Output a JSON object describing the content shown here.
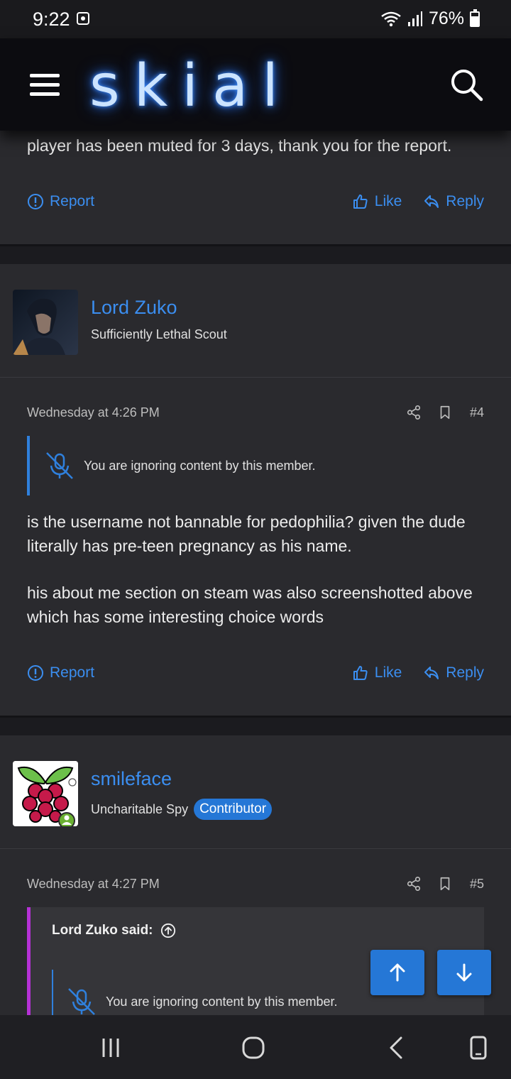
{
  "status_bar": {
    "time": "9:22",
    "battery": "76%"
  },
  "header": {
    "logo": "skial",
    "menu_icon": "hamburger-menu-icon",
    "search_icon": "search-icon"
  },
  "posts": [
    {
      "text_fragment": "player has been muted for 3 days, thank you for the report.",
      "actions": {
        "report": "Report",
        "like": "Like",
        "reply": "Reply"
      }
    },
    {
      "username": "Lord Zuko",
      "user_title": "Sufficiently Lethal Scout",
      "date": "Wednesday at 4:26 PM",
      "post_number": "#4",
      "ignored_notice": "You are ignoring content by this member.",
      "paragraphs": [
        "is the username not bannable for pedophilia? given the dude literally has pre-teen pregnancy as his name.",
        "his about me section on steam was also screenshotted above which has some interesting choice words"
      ],
      "actions": {
        "report": "Report",
        "like": "Like",
        "reply": "Reply"
      }
    },
    {
      "username": "smileface",
      "user_title": "Uncharitable Spy",
      "badge": "Contributor",
      "date": "Wednesday at 4:27 PM",
      "post_number": "#5",
      "quote_author": "Lord Zuko said:",
      "ignored_notice": "You are ignoring content by this member."
    }
  ],
  "colors": {
    "accent": "#3b8ef0",
    "badge": "#2577d6",
    "quote_border": "#b531d6",
    "post_bg": "#2a2a2e"
  }
}
